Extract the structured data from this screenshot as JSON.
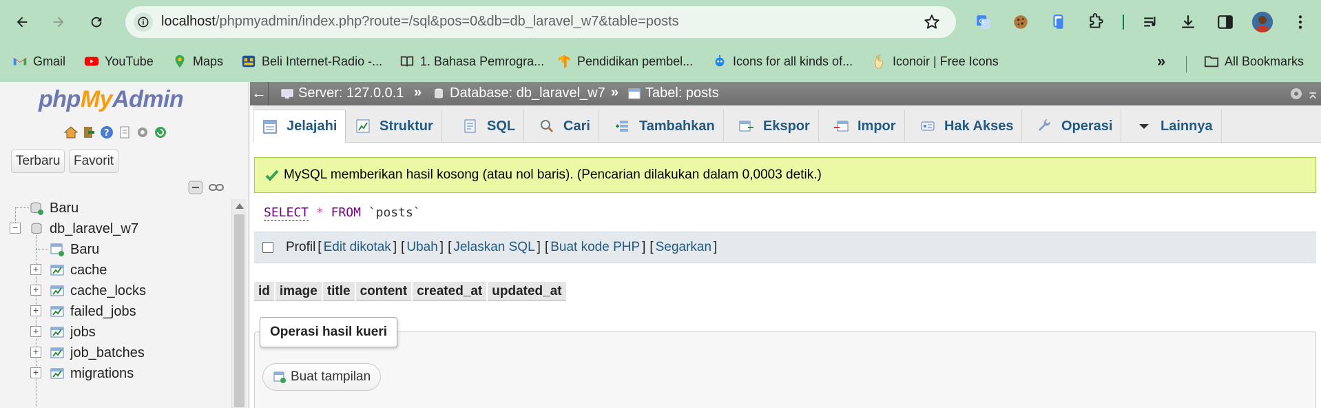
{
  "browser": {
    "url_host": "localhost",
    "url_path": "/phpmyadmin/index.php?route=/sql&pos=0&db=db_laravel_w7&table=posts",
    "bookmarks": [
      {
        "label": "Gmail"
      },
      {
        "label": "YouTube"
      },
      {
        "label": "Maps"
      },
      {
        "label": "Beli Internet-Radio -..."
      },
      {
        "label": "1. Bahasa Pemrogra..."
      },
      {
        "label": "Pendidikan pembel..."
      },
      {
        "label": "Icons for all kinds of..."
      },
      {
        "label": "Iconoir | Free Icons"
      }
    ],
    "more_label": "»",
    "all_bookmarks": "All Bookmarks"
  },
  "nav": {
    "logo": {
      "php": "php",
      "my": "My",
      "admin": "Admin"
    },
    "tab_recent": "Terbaru",
    "tab_favorite": "Favorit",
    "tree": [
      {
        "label": "Baru"
      },
      {
        "label": "db_laravel_w7"
      },
      {
        "label": "Baru"
      },
      {
        "label": "cache"
      },
      {
        "label": "cache_locks"
      },
      {
        "label": "failed_jobs"
      },
      {
        "label": "jobs"
      },
      {
        "label": "job_batches"
      },
      {
        "label": "migrations"
      }
    ]
  },
  "breadcrumb": {
    "server": "Server: 127.0.0.1",
    "database": "Database: db_laravel_w7",
    "table": "Tabel: posts",
    "sep": "»",
    "back": "←"
  },
  "tabs": [
    {
      "label": "Jelajahi"
    },
    {
      "label": "Struktur"
    },
    {
      "label": "SQL"
    },
    {
      "label": "Cari"
    },
    {
      "label": "Tambahkan"
    },
    {
      "label": "Ekspor"
    },
    {
      "label": "Impor"
    },
    {
      "label": "Hak Akses"
    },
    {
      "label": "Operasi"
    },
    {
      "label": "Lainnya"
    }
  ],
  "message": "MySQL memberikan hasil kosong (atau nol baris). (Pencarian dilakukan dalam 0,0003 detik.)",
  "sql": {
    "select": "SELECT",
    "star": "*",
    "from": "FROM",
    "table": "`posts`"
  },
  "tools": {
    "profil": "Profil",
    "edit_inline": "Edit dikotak",
    "edit": "Ubah",
    "explain": "Jelaskan SQL",
    "php_code": "Buat kode PHP",
    "refresh": "Segarkan"
  },
  "columns": [
    "id",
    "image",
    "title",
    "content",
    "created_at",
    "updated_at"
  ],
  "ops": {
    "legend": "Operasi hasil kueri",
    "create_view": "Buat tampilan"
  }
}
